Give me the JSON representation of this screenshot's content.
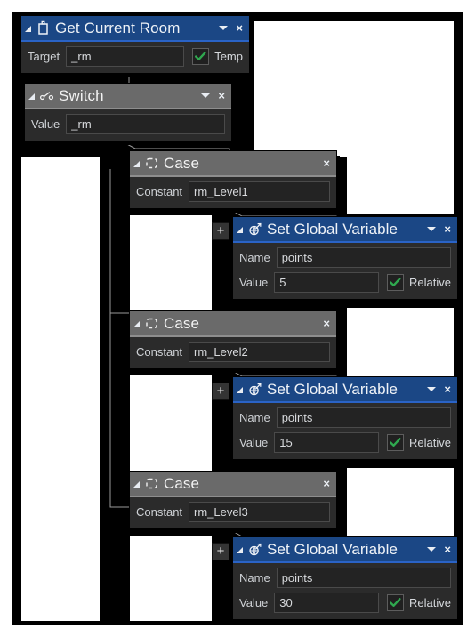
{
  "app": {
    "type": "visual-node-editor",
    "background": "#ffffff",
    "frame_color": "#000000"
  },
  "theme": {
    "accent_blue": "#1b4785",
    "accent_blue_underline": "#2a63c6",
    "grey_header": "#6a6a6a",
    "panel_body": "#2b2b2b",
    "input_bg": "#232323",
    "check_green": "#2fa84f",
    "text": "#eef2f7",
    "wire_color": "#9a9a9a"
  },
  "nodes": [
    {
      "id": "get-current-room",
      "title": "Get Current Room",
      "icon": "room-icon",
      "header_style": "blue",
      "has_caret": true,
      "has_close": true,
      "has_collapse": true,
      "fields": [
        {
          "label": "Target",
          "value": "_rm",
          "type": "text"
        }
      ],
      "checkbox": {
        "label": "Temp",
        "checked": true
      }
    },
    {
      "id": "switch",
      "title": "Switch",
      "icon": "switch-icon",
      "header_style": "grey",
      "has_caret": true,
      "has_close": true,
      "has_collapse": true,
      "fields": [
        {
          "label": "Value",
          "value": "_rm",
          "type": "text"
        }
      ],
      "checkbox": null
    },
    {
      "id": "case-1",
      "title": "Case",
      "icon": "case-icon",
      "header_style": "grey",
      "has_caret": false,
      "has_close": true,
      "has_collapse": true,
      "fields": [
        {
          "label": "Constant",
          "value": "rm_Level1",
          "type": "text"
        }
      ],
      "checkbox": null
    },
    {
      "id": "set-global-variable-1",
      "title": "Set Global Variable",
      "icon": "global-variable-icon",
      "header_style": "blue",
      "has_caret": true,
      "has_close": true,
      "has_collapse": true,
      "plus_button": "+",
      "fields": [
        {
          "label": "Name",
          "value": "points",
          "type": "text"
        },
        {
          "label": "Value",
          "value": "5",
          "type": "text"
        }
      ],
      "checkbox": {
        "label": "Relative",
        "checked": true
      }
    },
    {
      "id": "case-2",
      "title": "Case",
      "icon": "case-icon",
      "header_style": "grey",
      "has_caret": false,
      "has_close": true,
      "has_collapse": true,
      "fields": [
        {
          "label": "Constant",
          "value": "rm_Level2",
          "type": "text"
        }
      ],
      "checkbox": null
    },
    {
      "id": "set-global-variable-2",
      "title": "Set Global Variable",
      "icon": "global-variable-icon",
      "header_style": "blue",
      "has_caret": true,
      "has_close": true,
      "has_collapse": true,
      "plus_button": "+",
      "fields": [
        {
          "label": "Name",
          "value": "points",
          "type": "text"
        },
        {
          "label": "Value",
          "value": "15",
          "type": "text"
        }
      ],
      "checkbox": {
        "label": "Relative",
        "checked": true
      }
    },
    {
      "id": "case-3",
      "title": "Case",
      "icon": "case-icon",
      "header_style": "grey",
      "has_caret": false,
      "has_close": true,
      "has_collapse": true,
      "fields": [
        {
          "label": "Constant",
          "value": "rm_Level3",
          "type": "text"
        }
      ],
      "checkbox": null
    },
    {
      "id": "set-global-variable-3",
      "title": "Set Global Variable",
      "icon": "global-variable-icon",
      "header_style": "blue",
      "has_caret": true,
      "has_close": true,
      "has_collapse": true,
      "plus_button": "+",
      "fields": [
        {
          "label": "Name",
          "value": "points",
          "type": "text"
        },
        {
          "label": "Value",
          "value": "30",
          "type": "text"
        }
      ],
      "checkbox": {
        "label": "Relative",
        "checked": true
      }
    }
  ],
  "glyphs": {
    "close": "×",
    "plus": "+"
  }
}
